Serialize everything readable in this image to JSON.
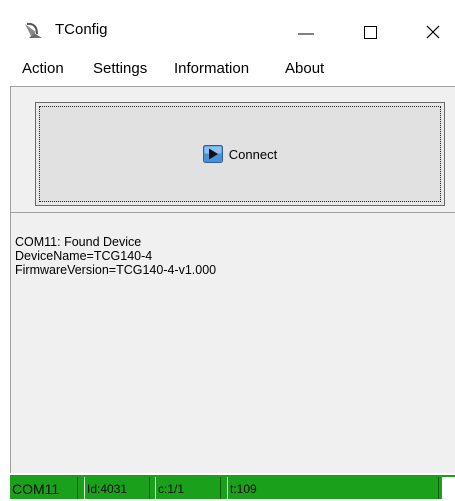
{
  "window": {
    "title": "TConfig",
    "icon": "satellite-dish-icon"
  },
  "menu": {
    "items": [
      "Action",
      "Settings",
      "Information",
      "About"
    ]
  },
  "connect": {
    "label": "Connect",
    "icon": "play-icon"
  },
  "log": {
    "lines": [
      "COM11: Found Device",
      "DeviceName=TCG140-4",
      "FirmwareVersion=TCG140-4-v1.000"
    ]
  },
  "status": {
    "port": "COM11",
    "id": "Id:4031",
    "c": "c:1/1",
    "t": "t:109",
    "color": "#1aa01a"
  }
}
